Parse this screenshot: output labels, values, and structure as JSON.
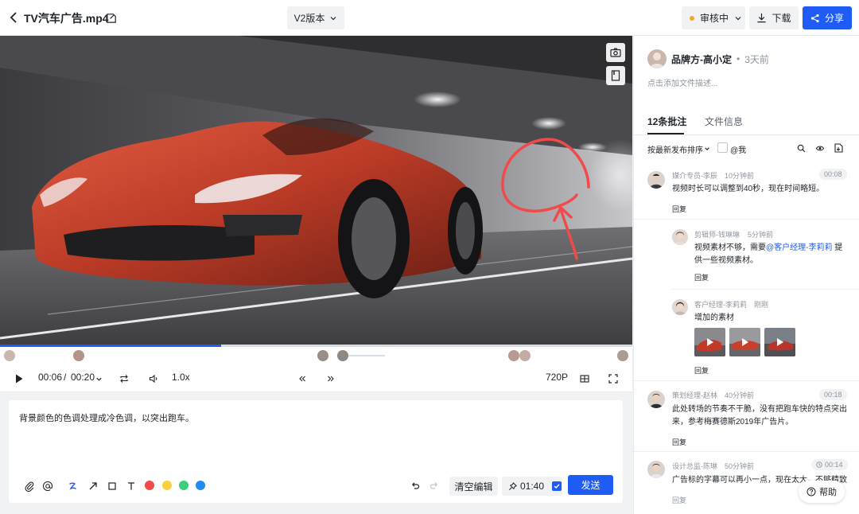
{
  "header": {
    "file_title": "TV汽车广告.mp4",
    "version_label": "V2版本",
    "status_label": "审核中",
    "download_label": "下载",
    "share_label": "分享"
  },
  "player": {
    "current_time": "00:06",
    "separator": "/",
    "duration": "00:20",
    "speed": "1.0x",
    "quality": "720P",
    "progress_fraction": 0.35
  },
  "composer": {
    "text": "背景颜色的色调处理成冷色调，以突出跑车。",
    "clear_label": "清空编辑",
    "timestamp": "01:40",
    "send_label": "发送",
    "colors": [
      "#f24949",
      "#f8d13e",
      "#3ad07a",
      "#1e8cf2"
    ]
  },
  "panel": {
    "owner_name": "品牌方-高小定",
    "owner_time": "3天前",
    "description_placeholder": "点击添加文件描述...",
    "tab_comments": "12条批注",
    "tab_info": "文件信息",
    "sort_label": "按最新发布排序",
    "mention_me": "@我",
    "comments": [
      {
        "author": "媒介专员-李辰",
        "time": "10分钟前",
        "badge": "00:08",
        "text": "视频时长可以调整到40秒，现在时间略短。",
        "reply": "回复"
      },
      {
        "author": "剪辑师-钱琳琳",
        "time": "5分钟前",
        "text_before": "视频素材不够，需要",
        "mention": "@客户经理-李莉莉",
        "text_after": " 提",
        "text_line2": "供一些视频素材。",
        "reply": "回复"
      },
      {
        "author": "客户经理-李莉莉",
        "time": "刚刚",
        "text": "增加的素材",
        "reply": "回复"
      },
      {
        "author": "策划经理-赵林",
        "time": "40分钟前",
        "badge": "00:18",
        "text_line1": "此处转场的节奏不干脆，没有把跑车快的特点突出",
        "text_line2": "来，参考梅赛德斯2019年广告片。",
        "reply": "回复"
      },
      {
        "author": "设计总监-陈琳",
        "time": "50分钟前",
        "badge": "00:14",
        "text": "广告标的字幕可以再小一点，现在太大，不够精致",
        "reply": "回复"
      }
    ],
    "help_label": "帮助"
  }
}
